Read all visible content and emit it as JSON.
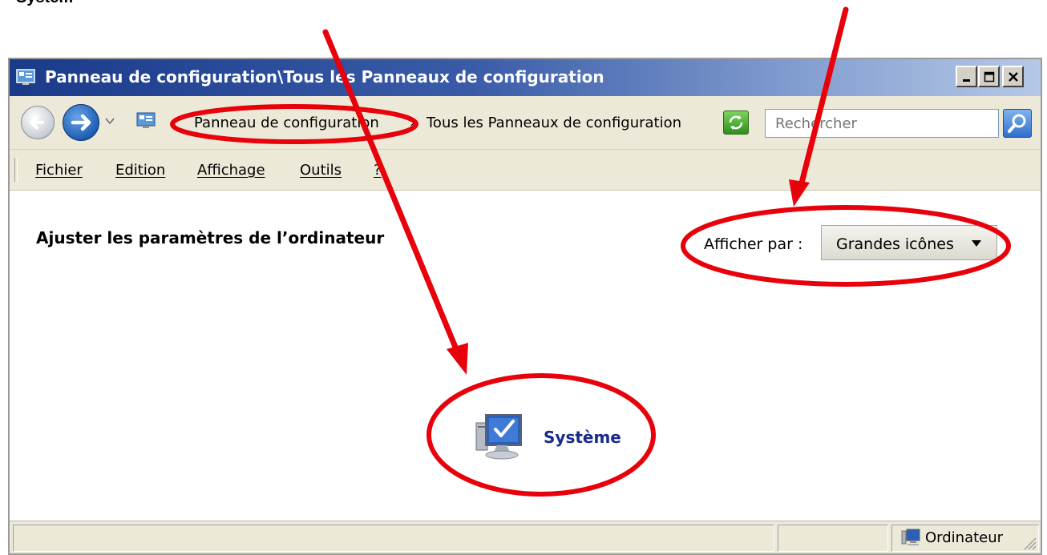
{
  "caption": "Systèm",
  "window": {
    "title": "Panneau de configuration\\Tous les Panneaux de configuration"
  },
  "address": {
    "crumbs": [
      "Panneau de configuration",
      "Tous les Panneaux de configuration"
    ],
    "separator": "›",
    "search_placeholder": "Rechercher"
  },
  "menu": {
    "items": [
      "Fichier",
      "Edition",
      "Affichage",
      "Outils",
      "?"
    ]
  },
  "content": {
    "heading": "Ajuster les paramètres de l’ordinateur",
    "view_by_label": "Afficher par :",
    "view_by_value": "Grandes icônes",
    "item_label": "Système"
  },
  "status": {
    "computer_label": "Ordinateur"
  },
  "colors": {
    "annotation": "#e8000b",
    "title_bar": "#1a3a8a",
    "link_text": "#1a2a8a"
  },
  "icons": {
    "back": "back-arrow-icon",
    "forward": "forward-arrow-icon",
    "control_panel": "control-panel-icon",
    "refresh": "refresh-icon",
    "search": "magnifier-icon",
    "system": "system-computer-icon",
    "computer": "computer-icon"
  }
}
